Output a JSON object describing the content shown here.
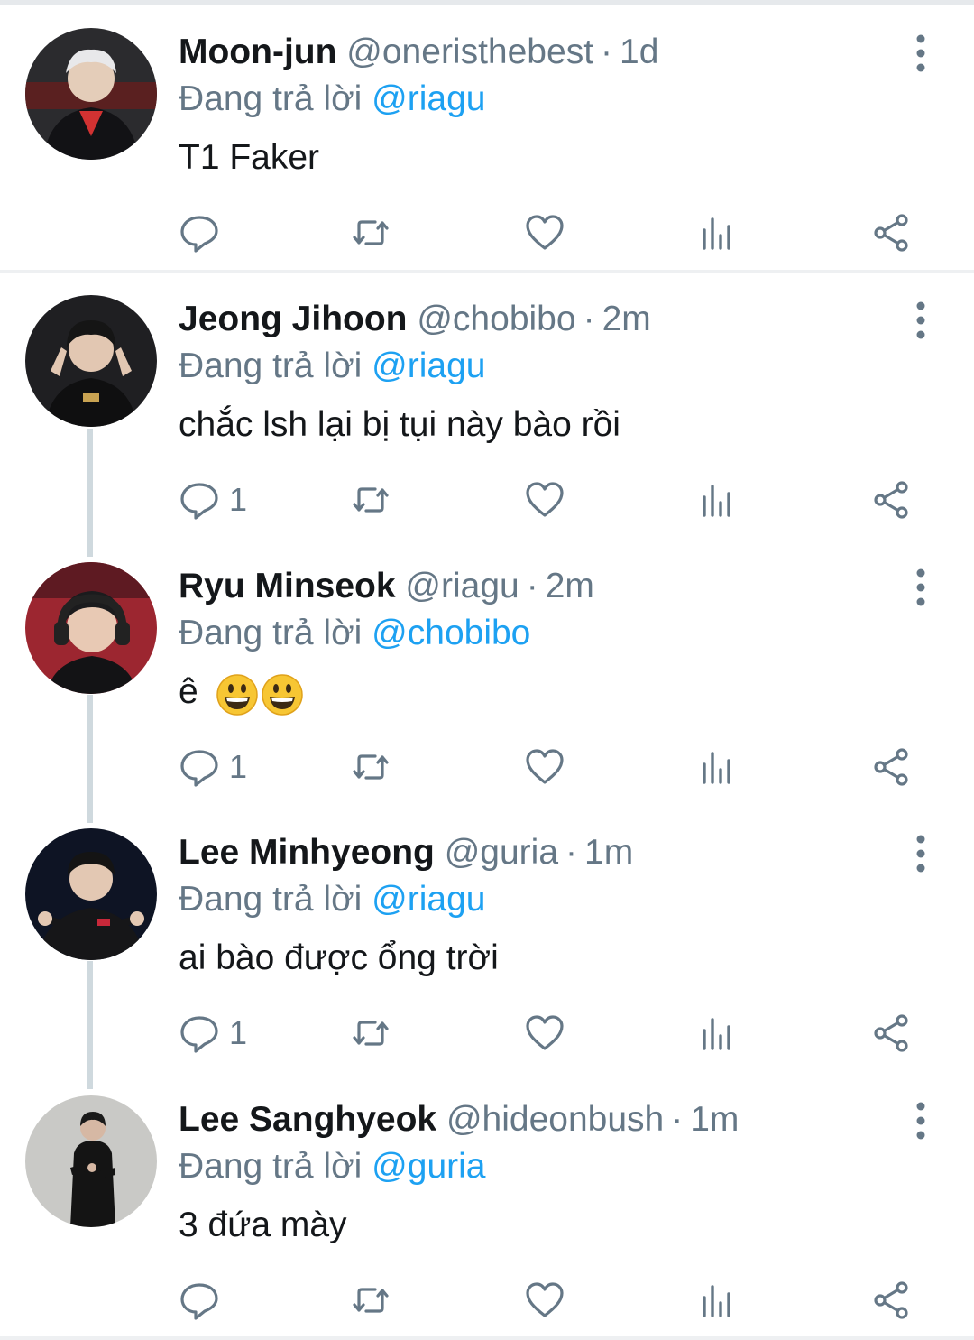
{
  "colors": {
    "name": "#14171a",
    "secondary": "#657786",
    "mention": "#1da1f2",
    "divider": "#eef0f2",
    "thread_line": "#cfd9de"
  },
  "tweets": [
    {
      "name": "Moon-jun",
      "handle": "@oneristhebest",
      "separator": "·",
      "time": "1d",
      "reply_prefix": "Đang trả lời",
      "reply_to": "@riagu",
      "text": "T1 Faker",
      "reply_count": "",
      "avatar": "avatar-photo"
    },
    {
      "name": "Jeong Jihoon",
      "handle": "@chobibo",
      "separator": "·",
      "time": "2m",
      "reply_prefix": "Đang trả lời",
      "reply_to": "@riagu",
      "text": "chắc lsh lại bị tụi này bào rồi",
      "reply_count": "1",
      "avatar": "avatar-photo"
    },
    {
      "name": "Ryu Minseok",
      "handle": "@riagu",
      "separator": "·",
      "time": "2m",
      "reply_prefix": "Đang trả lời",
      "reply_to": "@chobibo",
      "text": "ê",
      "emojis": [
        "grinning-face-emoji",
        "grinning-face-emoji"
      ],
      "reply_count": "1",
      "avatar": "avatar-photo"
    },
    {
      "name": "Lee Minhyeong",
      "handle": "@guria",
      "separator": "·",
      "time": "1m",
      "reply_prefix": "Đang trả lời",
      "reply_to": "@riagu",
      "text": "ai bào được ổng trời",
      "reply_count": "1",
      "avatar": "avatar-photo"
    },
    {
      "name": "Lee Sanghyeok",
      "handle": "@hideonbush",
      "separator": "·",
      "time": "1m",
      "reply_prefix": "Đang trả lời",
      "reply_to": "@guria",
      "text": "3 đứa mày",
      "reply_count": "",
      "avatar": "avatar-photo"
    }
  ]
}
